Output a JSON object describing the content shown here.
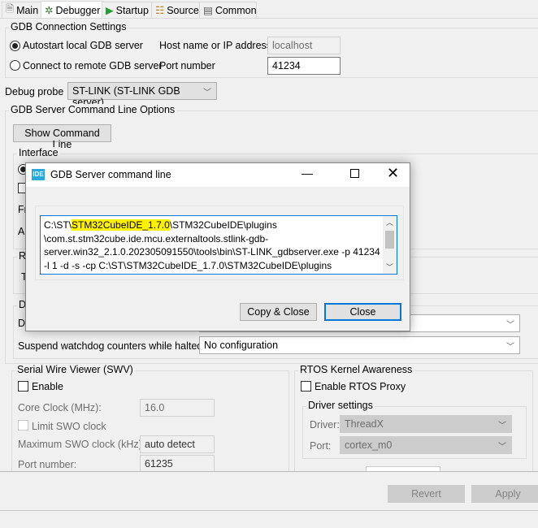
{
  "tabs": [
    {
      "label": "Main",
      "icon": "file-icon"
    },
    {
      "label": "Debugger",
      "icon": "bug-icon"
    },
    {
      "label": "Startup",
      "icon": "play-icon"
    },
    {
      "label": "Source",
      "icon": "source-icon"
    },
    {
      "label": "Common",
      "icon": "window-icon"
    }
  ],
  "gdb": {
    "title": "GDB Connection Settings",
    "autostart": "Autostart local GDB server",
    "remote": "Connect to remote GDB server",
    "host_label": "Host name or IP address",
    "host_value": "localhost",
    "port_label": "Port number",
    "port_value": "41234"
  },
  "probe": {
    "label": "Debug probe",
    "value": "ST-LINK (ST-LINK GDB server)"
  },
  "cmdopts": {
    "title": "GDB Server Command Line Options",
    "show_btn": "Show Command Line",
    "interface": "Interface",
    "frag_f": "Fr",
    "frag_a": "A",
    "frag_r": "R",
    "frag_t": "T",
    "frag_d": "D",
    "frag_d2": "D",
    "suspend_label": "Suspend watchdog counters while halted:",
    "suspend_value": "No configuration"
  },
  "swv": {
    "title": "Serial Wire Viewer (SWV)",
    "enable": "Enable",
    "core_clock_label": "Core Clock (MHz):",
    "core_clock_value": "16.0",
    "limit": "Limit SWO clock",
    "max_label": "Maximum SWO clock (kHz):",
    "max_value": "auto detect",
    "port_label": "Port number:",
    "port_value": "61235"
  },
  "rtos": {
    "title": "RTOS Kernel Awareness",
    "enable": "Enable RTOS Proxy",
    "driver_settings": "Driver settings",
    "driver_label": "Driver:",
    "driver_value": "ThreadX",
    "port_label": "Port:",
    "port_value": "cortex_m0"
  },
  "footer": {
    "revert": "Revert",
    "apply": "Apply"
  },
  "dialog": {
    "icon_text": "IDE",
    "title": "GDB Server command line",
    "cmd_pre": "C:\\ST\\",
    "cmd_hl": "STM32CubeIDE_1.7.0",
    "cmd_line1_post": "\\STM32CubeIDE\\plugins",
    "cmd_line2": "\\com.st.stm32cube.ide.mcu.externaltools.stlink-gdb-",
    "cmd_line3": "server.win32_2.1.0.202305091550\\tools\\bin\\ST-LINK_gdbserver.exe -p 41234",
    "cmd_line4": "-l 1 -d -s -cp C:\\ST\\STM32CubeIDE_1.7.0\\STM32CubeIDE\\plugins",
    "copy_close": "Copy & Close",
    "close": "Close",
    "highlight_color": "#fff200",
    "accent": "#0078d7"
  }
}
